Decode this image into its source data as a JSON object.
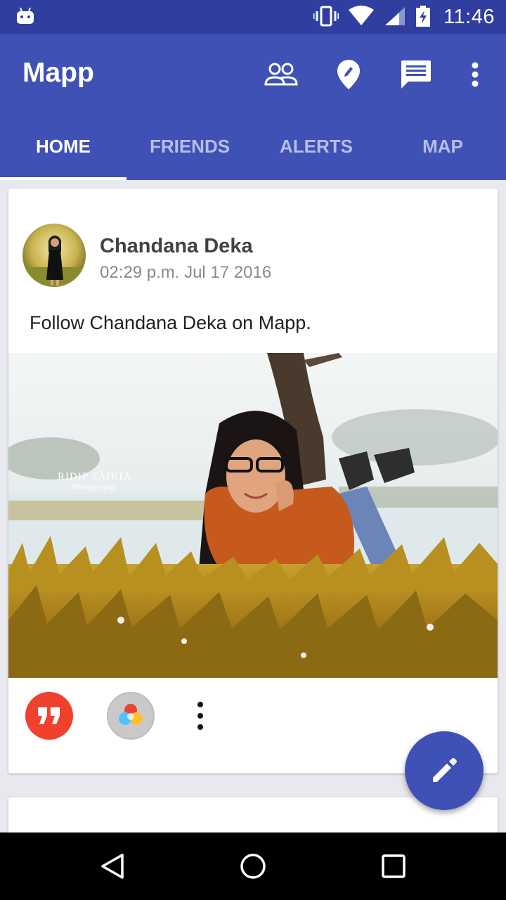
{
  "status_bar": {
    "time": "11:46",
    "icons": [
      "android-icon",
      "vibrate-icon",
      "wifi-icon",
      "signal-icon",
      "battery-charging-icon"
    ]
  },
  "app_bar": {
    "title": "Mapp",
    "actions": [
      "people-icon",
      "location-edit-icon",
      "message-icon",
      "more-vert-icon"
    ],
    "color": "#3f51b5"
  },
  "tabs": [
    {
      "label": "HOME",
      "active": true
    },
    {
      "label": "FRIENDS",
      "active": false
    },
    {
      "label": "ALERTS",
      "active": false
    },
    {
      "label": "MAP",
      "active": false
    }
  ],
  "post": {
    "author": "Chandana Deka",
    "timestamp": "02:29 p.m. Jul 17 2016",
    "text": "Follow Chandana Deka on Mapp.",
    "watermark_line1": "RIDIP SAIKIA",
    "watermark_line2": "Photography"
  },
  "fab": {
    "icon": "edit-icon",
    "color": "#3f51b5"
  },
  "nav": [
    "back-icon",
    "home-icon",
    "recents-icon"
  ]
}
